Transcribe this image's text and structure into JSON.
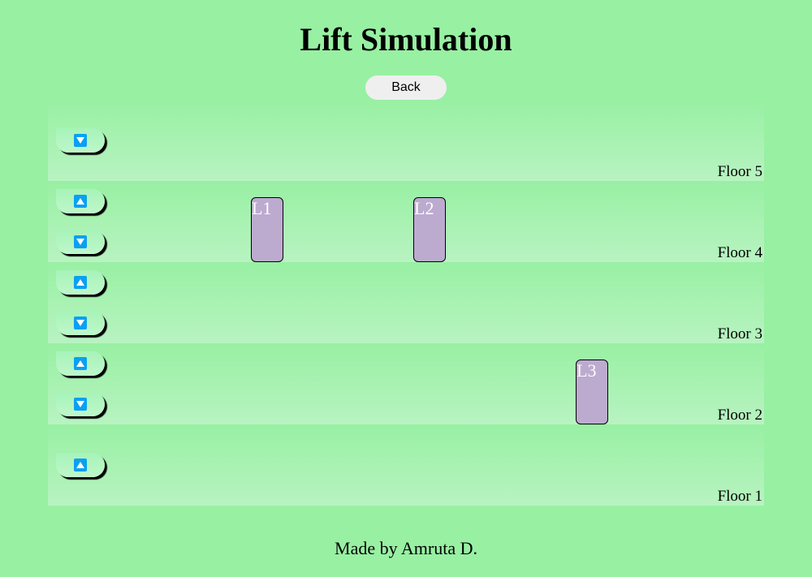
{
  "page": {
    "title": "Lift Simulation",
    "back_label": "Back",
    "footer": "Made by Amruta D."
  },
  "colors": {
    "background": "#98f0a3",
    "lift": "#bcabcf",
    "arrow": "#0aa0f4",
    "button_face": "#efefef"
  },
  "floors": [
    {
      "label": "Floor 5",
      "buttons": [
        "down"
      ]
    },
    {
      "label": "Floor 4",
      "buttons": [
        "up",
        "down"
      ]
    },
    {
      "label": "Floor 3",
      "buttons": [
        "up",
        "down"
      ]
    },
    {
      "label": "Floor 2",
      "buttons": [
        "up",
        "down"
      ]
    },
    {
      "label": "Floor 1",
      "buttons": [
        "up"
      ]
    }
  ],
  "lifts": [
    {
      "label": "L1",
      "floor": 4
    },
    {
      "label": "L2",
      "floor": 4
    },
    {
      "label": "L3",
      "floor": 2
    }
  ],
  "icons": {
    "up": "arrow-up-icon",
    "down": "arrow-down-icon"
  }
}
